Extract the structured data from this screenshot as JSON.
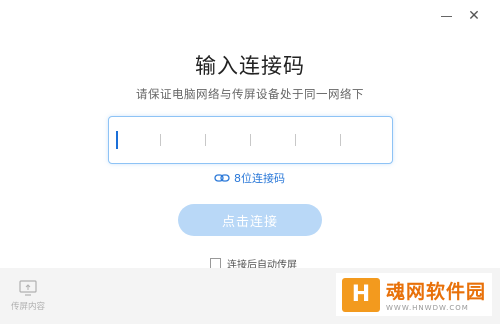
{
  "window": {
    "minimize_glyph": "—",
    "close_glyph": "✕"
  },
  "dialog": {
    "title": "输入连接码",
    "subtitle": "请保证电脑网络与传屏设备处于同一网络下",
    "code_input": {
      "value": "",
      "cell_count": 8
    },
    "digits_link_label": "8位连接码",
    "connect_button_label": "点击连接",
    "auto_cast_label": "连接后自动传屏",
    "auto_cast_checked": false
  },
  "sidebar": {
    "cast_content_label": "传屏内容"
  },
  "watermark": {
    "logo_glyph": "H",
    "text": "魂网软件园",
    "url": "WWW.HNWDW.COM"
  },
  "colors": {
    "accent": "#2a78d8",
    "button_disabled": "#b9d8f7",
    "input_border": "#8ec3f5",
    "watermark": "#e8710a"
  }
}
